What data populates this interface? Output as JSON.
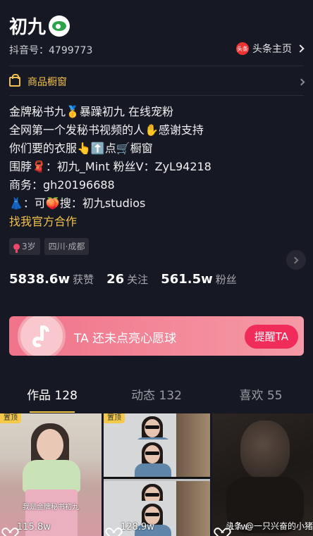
{
  "profile": {
    "name": "初九",
    "douyin_id": "抖音号：4799773",
    "toutiao_logo": "头条",
    "toutiao_label": "头条主页"
  },
  "shop": {
    "label": "商品橱窗"
  },
  "bio": {
    "lines": [
      "金牌秘书九🥇暴躁初九 在线宠粉",
      "全网第一个发秘书视频的人✋感谢支持",
      "你们要的衣服👆⬆️点🛒橱窗",
      "围脖🧣：初九_Mint  粉丝V：ZyL94218",
      "商务：gh20196688",
      "👗：可🍑搜：初九studios"
    ],
    "collab": "找我官方合作"
  },
  "tags": {
    "age": "3岁",
    "location": "四川·成都"
  },
  "stats": {
    "likes_num": "5838.6w",
    "likes_label": "获赞",
    "following_num": "26",
    "following_label": "关注",
    "followers_num": "561.5w",
    "followers_label": "粉丝"
  },
  "wish": {
    "text": "TA 还未点亮心愿球",
    "button": "提醒TA"
  },
  "tabs": [
    "作品 128",
    "动态 132",
    "喜欢 55"
  ],
  "videos": [
    {
      "pin": "置顶",
      "caption": "我是金牌秘书初九",
      "likes": "115.8w"
    },
    {
      "pin": "置顶",
      "likes": "128.9w"
    },
    {
      "likes": "17w"
    }
  ],
  "watermark": "头条 @一只兴奋的小猪",
  "colors": {
    "background": "#161823",
    "accent_yellow": "#f2c14e",
    "remind_red": "#f02d5a"
  }
}
